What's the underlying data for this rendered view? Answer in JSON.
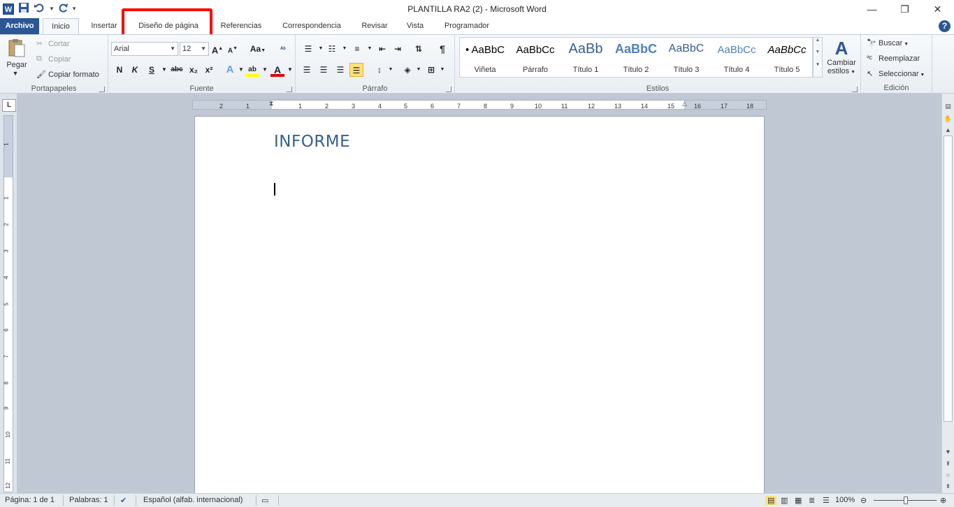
{
  "window": {
    "title": "PLANTILLA RA2 (2)  -  Microsoft Word"
  },
  "qat": {
    "app_icon": "W"
  },
  "tabs": [
    {
      "label": "Archivo"
    },
    {
      "label": "Inicio"
    },
    {
      "label": "Insertar"
    },
    {
      "label": "Diseño de página"
    },
    {
      "label": "Referencias"
    },
    {
      "label": "Correspondencia"
    },
    {
      "label": "Revisar"
    },
    {
      "label": "Vista"
    },
    {
      "label": "Programador"
    }
  ],
  "clipboard": {
    "paste": "Pegar",
    "cut": "Cortar",
    "copy": "Copiar",
    "format_painter": "Copiar formato",
    "label": "Portapapeles"
  },
  "font": {
    "name": "Arial",
    "size": "12",
    "bold": "N",
    "italic": "K",
    "underline": "S",
    "strike": "abc",
    "subscript": "x₂",
    "superscript": "x²",
    "grow": "A",
    "shrink": "A",
    "change_case": "Aa",
    "label": "Fuente"
  },
  "paragraph": {
    "pilcrow": "¶",
    "label": "Párrafo"
  },
  "styles": {
    "items": [
      {
        "preview": "• AaBbC",
        "name": "Viñeta"
      },
      {
        "preview": "AaBbCc",
        "name": "Párrafo"
      },
      {
        "preview": "AaBb",
        "name": "Título 1"
      },
      {
        "preview": "AaBbC",
        "name": "Título 2"
      },
      {
        "preview": "AaBbC",
        "name": "Título 3"
      },
      {
        "preview": "AaBbCc",
        "name": "Título 4"
      },
      {
        "preview": "AaBbCc",
        "name": "Título 5"
      }
    ],
    "change_styles": "Cambiar estilos",
    "label": "Estilos"
  },
  "editing": {
    "find": "Buscar",
    "replace": "Reemplazar",
    "select": "Seleccionar",
    "label": "Edición"
  },
  "ruler": {
    "corner": "L",
    "ticks": [
      "1",
      "2",
      "1",
      "1",
      "2",
      "3",
      "4",
      "5",
      "6",
      "7",
      "8",
      "9",
      "10",
      "11",
      "12",
      "13",
      "14",
      "15",
      "16",
      "17",
      "18"
    ],
    "vticks": [
      "1",
      "1",
      "2",
      "3",
      "4",
      "5",
      "6",
      "7",
      "8",
      "9",
      "10",
      "11",
      "12",
      "13",
      "14"
    ]
  },
  "document": {
    "heading": "INFORME"
  },
  "status": {
    "page": "Página: 1 de 1",
    "words": "Palabras: 1",
    "language": "Español (alfab. internacional)",
    "zoom": "100%"
  },
  "colors": {
    "accent": "#2b5797",
    "heading": "#365f91",
    "highlight_box": "#ff0000"
  }
}
